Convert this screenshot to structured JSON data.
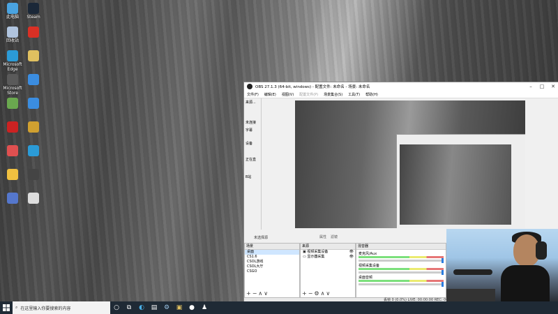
{
  "desktop": {
    "icons": [
      {
        "label": "此电脑",
        "color": "#4aa3e0"
      },
      {
        "label": "Steam",
        "color": "#1b2838"
      },
      {
        "label": "回收站",
        "color": "#b0c4de"
      },
      {
        "label": "",
        "color": "#d93025"
      },
      {
        "label": "Microsoft Edge",
        "color": "#2b9bd7"
      },
      {
        "label": "",
        "color": "#e0c060"
      },
      {
        "label": "Microsoft Store",
        "color": "#5a5a5a"
      },
      {
        "label": "",
        "color": "#3b8de0"
      },
      {
        "label": "",
        "color": "#6aa84f"
      },
      {
        "label": "",
        "color": "#3b8de0"
      },
      {
        "label": "",
        "color": "#cc2222"
      },
      {
        "label": "",
        "color": "#d0a030"
      },
      {
        "label": "",
        "color": "#e05050"
      },
      {
        "label": "",
        "color": "#2b9bd7"
      },
      {
        "label": "",
        "color": "#f0c040"
      },
      {
        "label": "",
        "color": "#444"
      },
      {
        "label": "",
        "color": "#5577cc"
      },
      {
        "label": "",
        "color": "#dddddd"
      }
    ]
  },
  "obs": {
    "title": "OBS 27.1.3 (64-bit, windows) - 配置文件: 未命名 - 场景: 未命名",
    "menu": [
      "文件(F)",
      "编辑(E)",
      "视图(V)",
      "配置文件(P)",
      "场景集合(S)",
      "工具(T)",
      "帮助(H)"
    ],
    "left_labels": [
      "来源...",
      "未连接",
      "字幕",
      "设备",
      "",
      "正在直",
      "",
      "B站",
      ""
    ],
    "status_label": "未选择源",
    "preview_buttons": [
      "属性",
      "滤镜"
    ],
    "scenes": {
      "header": "场景",
      "items": [
        "桌面",
        "CS1.6",
        "CSOL游戏",
        "CSOL大厅",
        "CSGO"
      ]
    },
    "sources": {
      "header": "来源",
      "items": [
        "视频采集设备",
        "显示器采集"
      ]
    },
    "mixer": {
      "header": "混音器",
      "tracks": [
        "麦克风/Aux",
        "视频采集设备",
        "桌面音频"
      ]
    },
    "statusbar": "丢帧 0 (0.0%)    LIVE: 00:00:00    REC: 00:00:00    CPU: 12%"
  },
  "taskbar": {
    "search_placeholder": "在这里输入你要搜索的内容"
  }
}
